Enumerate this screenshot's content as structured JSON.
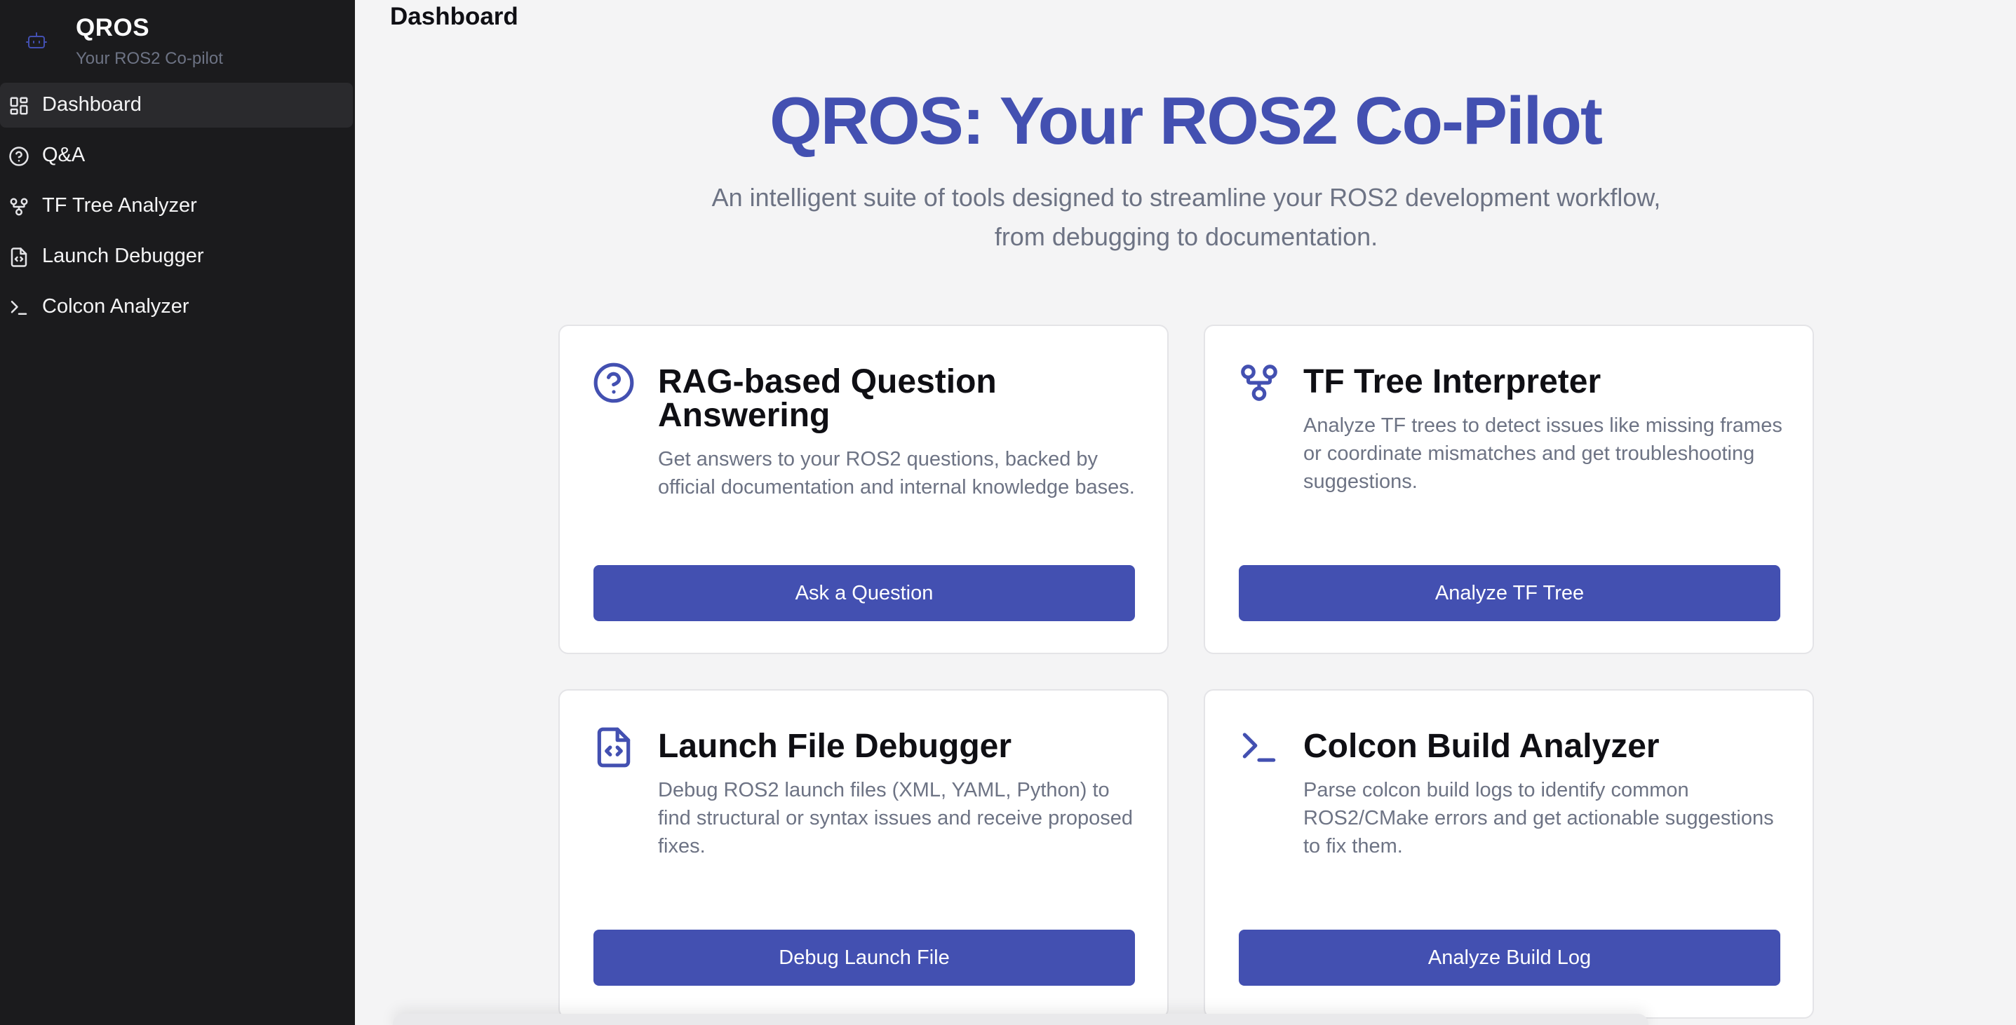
{
  "sidebar": {
    "app_name": "QROS",
    "app_subtitle": "Your ROS2 Co-pilot",
    "brand_icon": "robot-icon",
    "items": [
      {
        "label": "Dashboard",
        "icon": "layout-dashboard-icon",
        "active": true
      },
      {
        "label": "Q&A",
        "icon": "help-circle-icon",
        "active": false
      },
      {
        "label": "TF Tree Analyzer",
        "icon": "git-fork-icon",
        "active": false
      },
      {
        "label": "Launch Debugger",
        "icon": "file-code-icon",
        "active": false
      },
      {
        "label": "Colcon Analyzer",
        "icon": "terminal-icon",
        "active": false
      }
    ]
  },
  "header": {
    "title": "Dashboard"
  },
  "hero": {
    "title": "QROS: Your ROS2 Co-Pilot",
    "subtitle": "An intelligent suite of tools designed to streamline your ROS2 development workflow, from debugging to documentation."
  },
  "cards": [
    {
      "title": "RAG-based Question Answering",
      "description": "Get answers to your ROS2 questions, backed by official documentation and internal knowledge bases.",
      "button": "Ask a Question",
      "icon": "help-circle-icon"
    },
    {
      "title": "TF Tree Interpreter",
      "description": "Analyze TF trees to detect issues like missing frames or coordinate mismatches and get troubleshooting suggestions.",
      "button": "Analyze TF Tree",
      "icon": "git-fork-icon"
    },
    {
      "title": "Launch File Debugger",
      "description": "Debug ROS2 launch files (XML, YAML, Python) to find structural or syntax issues and receive proposed fixes.",
      "button": "Debug Launch File",
      "icon": "file-code-icon"
    },
    {
      "title": "Colcon Build Analyzer",
      "description": "Parse colcon build logs to identify common ROS2/CMake errors and get actionable suggestions to fix them.",
      "button": "Analyze Build Log",
      "icon": "terminal-icon"
    }
  ],
  "colors": {
    "accent": "#4350b1",
    "sidebar_bg": "#1b1b1d",
    "page_bg": "#f4f4f5",
    "muted_text": "#6d7384"
  }
}
